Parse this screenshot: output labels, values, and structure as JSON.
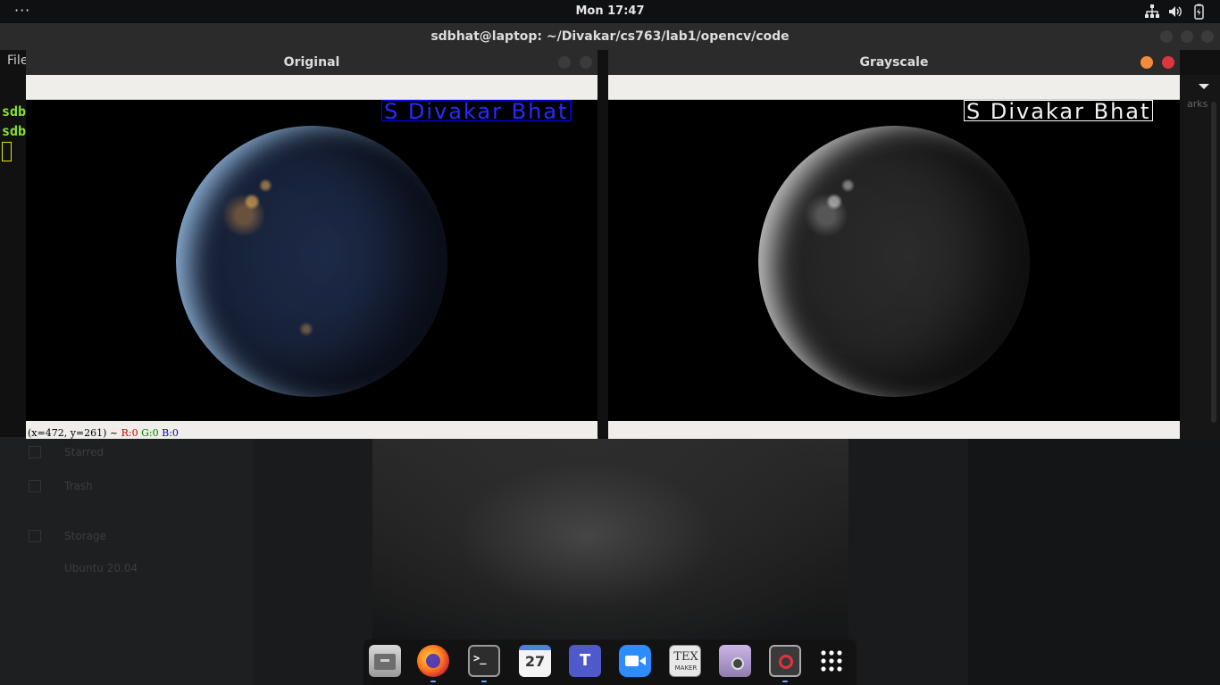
{
  "topbar": {
    "activities_label": "···",
    "clock": "Mon 17:47",
    "icons": [
      "network-icon",
      "volume-icon",
      "battery-icon"
    ]
  },
  "terminal": {
    "title": "sdbhat@laptop: ~/Divakar/cs763/lab1/opencv/code",
    "menu_label": "File",
    "prompt_1": "sdbl",
    "prompt_2": "sdbl"
  },
  "windows": {
    "original": {
      "title": "Original",
      "overlay_text": "S Divakar Bhat",
      "status": {
        "coords": "(x=472, y=261) ~ ",
        "r": "R:0",
        "g": "G:0",
        "b": "B:0"
      }
    },
    "grayscale": {
      "title": "Grayscale",
      "overlay_text": "S Divakar Bhat"
    }
  },
  "background_app": {
    "items": [
      "Starred",
      "Trash",
      "Storage",
      "Ubuntu 20.04"
    ],
    "right_label": "arks"
  },
  "dock": {
    "apps": [
      "files-icon",
      "firefox-icon",
      "terminal-icon",
      "calendar-icon",
      "teams-icon",
      "zoom-icon",
      "texmaker-icon",
      "screenshot-icon",
      "blocked-app-icon",
      "app-grid-icon"
    ],
    "calendar_day": "27",
    "teams_letter": "T",
    "texmaker_label": "TEX",
    "texmaker_sub": "MAKER"
  },
  "colors": {
    "prompt_green": "#8ae234",
    "overlay_blue": "#0000ff",
    "close_red": "#e0353f",
    "minimize_orange": "#f58a3a",
    "status_red": "#cc0000",
    "status_green": "#008000",
    "status_blue": "#0000cc"
  }
}
